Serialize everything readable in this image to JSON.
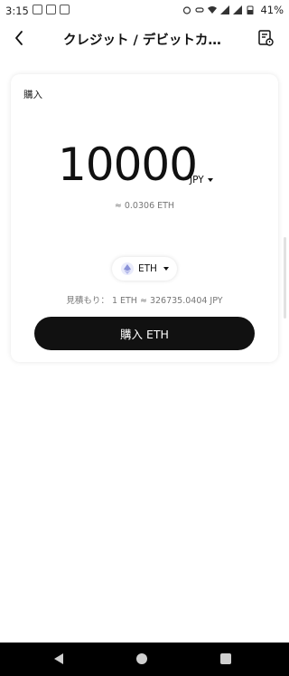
{
  "status_bar": {
    "time": "3:15",
    "battery": "41%",
    "icons": [
      "alarm-icon",
      "link-icon",
      "wifi-icon",
      "signal-icon",
      "signal-icon",
      "battery-icon"
    ]
  },
  "header": {
    "title": "クレジット / デビットカ…",
    "back_icon": "chevron-left-icon",
    "orders_icon": "order-history-icon"
  },
  "card": {
    "title": "購入",
    "amount": "10000",
    "fiat_currency": "JPY",
    "converted": "≈ 0.0306 ETH",
    "crypto": "ETH",
    "quote": "見積もり： 1 ETH ≈ 326735.0404 JPY",
    "buy_label": "購入 ETH"
  },
  "colors": {
    "button_bg": "#111111",
    "button_text": "#ffffff",
    "eth_badge": "#e9ebfb",
    "nav_bar": "#000000"
  }
}
